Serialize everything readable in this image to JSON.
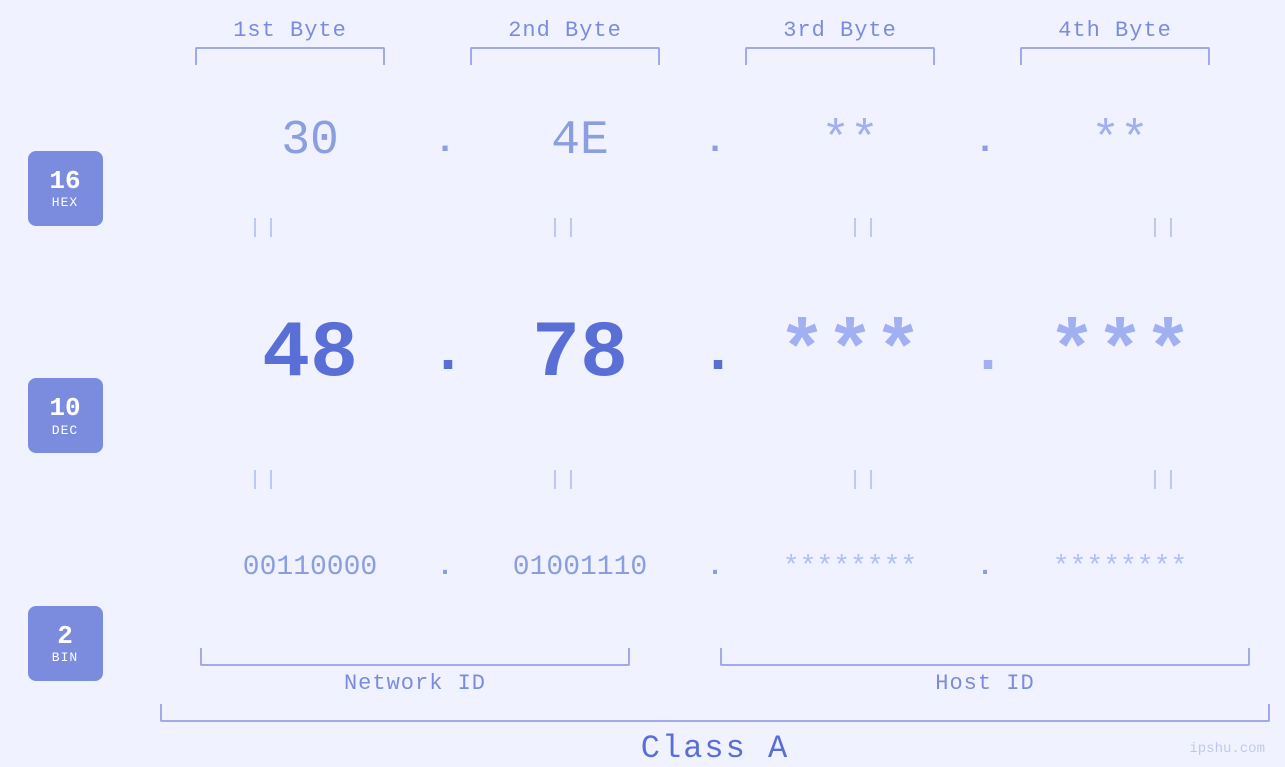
{
  "header": {
    "byte1_label": "1st Byte",
    "byte2_label": "2nd Byte",
    "byte3_label": "3rd Byte",
    "byte4_label": "4th Byte"
  },
  "badges": {
    "hex": {
      "number": "16",
      "label": "HEX"
    },
    "dec": {
      "number": "10",
      "label": "DEC"
    },
    "bin": {
      "number": "2",
      "label": "BIN"
    }
  },
  "hex_row": {
    "byte1": "30",
    "byte2": "4E",
    "byte3": "**",
    "byte4": "**",
    "dot": "."
  },
  "dec_row": {
    "byte1": "48",
    "byte2": "78",
    "byte3": "***",
    "byte4": "***",
    "dot": "."
  },
  "bin_row": {
    "byte1": "00110000",
    "byte2": "01001110",
    "byte3": "********",
    "byte4": "********",
    "dot": "."
  },
  "labels": {
    "network_id": "Network ID",
    "host_id": "Host ID",
    "class": "Class A"
  },
  "equals_sign": "||",
  "watermark": "ipshu.com"
}
